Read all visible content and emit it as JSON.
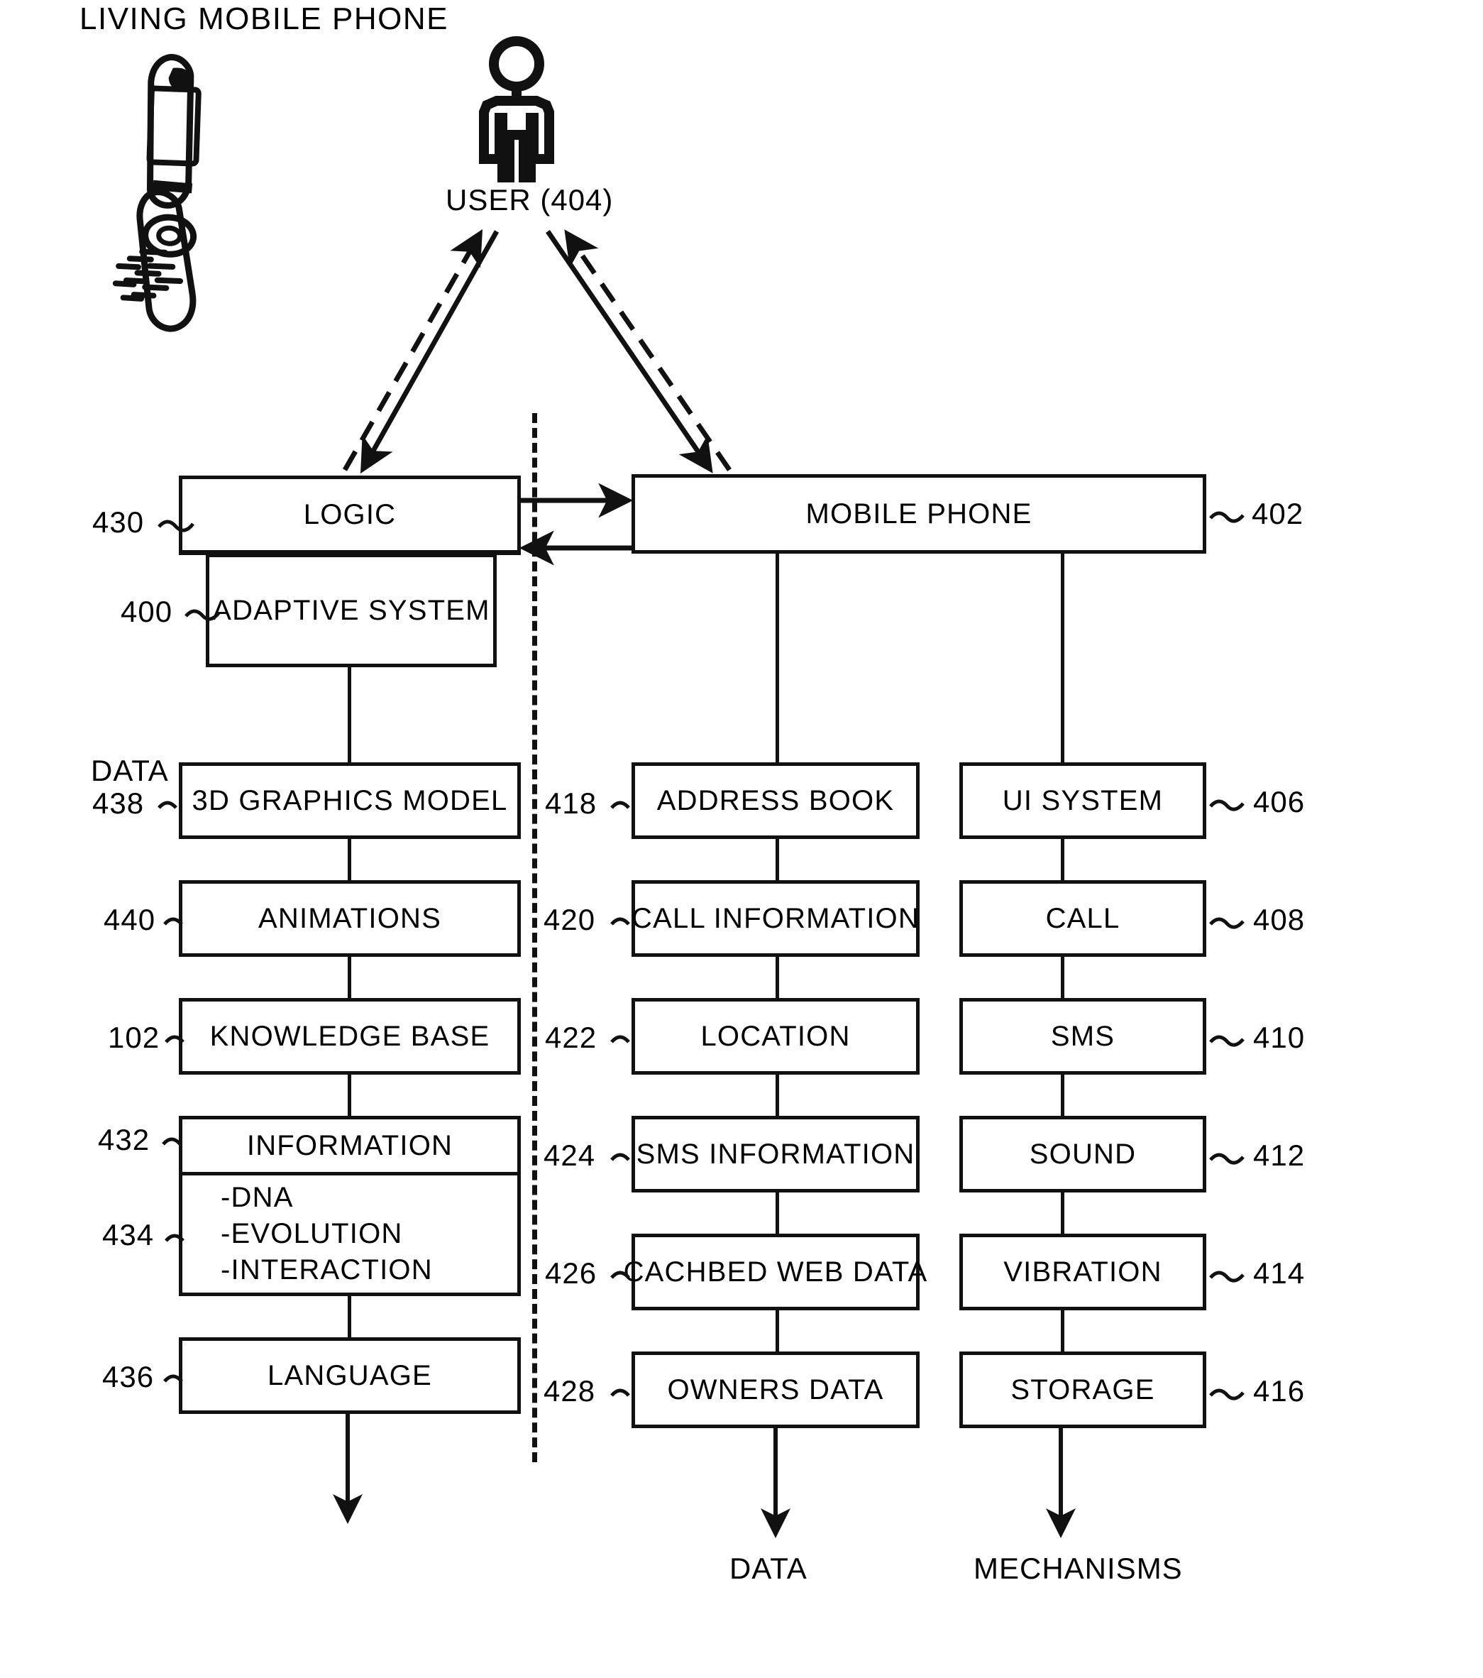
{
  "figure": {
    "title": "LIVING MOBILE PHONE",
    "user_label": "USER (404)",
    "data_side_label": "DATA",
    "bottom_labels": {
      "data": "DATA",
      "mechanisms": "MECHANISMS"
    }
  },
  "icons": {
    "phone": "flip-mobile-phone-icon",
    "user": "user-person-icon"
  },
  "top": {
    "logic": {
      "label": "LOGIC",
      "ref": "430"
    },
    "adaptive_system": {
      "label": "ADAPTIVE SYSTEM",
      "ref": "400"
    },
    "mobile_phone": {
      "label": "MOBILE PHONE",
      "ref": "402"
    }
  },
  "columns": {
    "left": {
      "name": "adaptive-system-data-column",
      "items": [
        {
          "label": "3D GRAPHICS MODEL",
          "ref": "438"
        },
        {
          "label": "ANIMATIONS",
          "ref": "440"
        },
        {
          "label": "KNOWLEDGE BASE",
          "ref": "102"
        }
      ],
      "information": {
        "label": "INFORMATION",
        "ref": "432",
        "items_ref": "434",
        "items": [
          "-DNA",
          "-EVOLUTION",
          "-INTERACTION"
        ]
      },
      "language": {
        "label": "LANGUAGE",
        "ref": "436"
      }
    },
    "middle": {
      "name": "phone-data-column",
      "items": [
        {
          "label": "ADDRESS BOOK",
          "ref": "418"
        },
        {
          "label": "CALL INFORMATION",
          "ref": "420"
        },
        {
          "label": "LOCATION",
          "ref": "422"
        },
        {
          "label": "SMS INFORMATION",
          "ref": "424"
        },
        {
          "label": "CACHBED WEB DATA",
          "ref": "426"
        },
        {
          "label": "OWNERS DATA",
          "ref": "428"
        }
      ]
    },
    "right": {
      "name": "phone-mechanisms-column",
      "items": [
        {
          "label": "UI SYSTEM",
          "ref": "406"
        },
        {
          "label": "CALL",
          "ref": "408"
        },
        {
          "label": "SMS",
          "ref": "410"
        },
        {
          "label": "SOUND",
          "ref": "412"
        },
        {
          "label": "VIBRATION",
          "ref": "414"
        },
        {
          "label": "STORAGE",
          "ref": "416"
        }
      ]
    }
  }
}
